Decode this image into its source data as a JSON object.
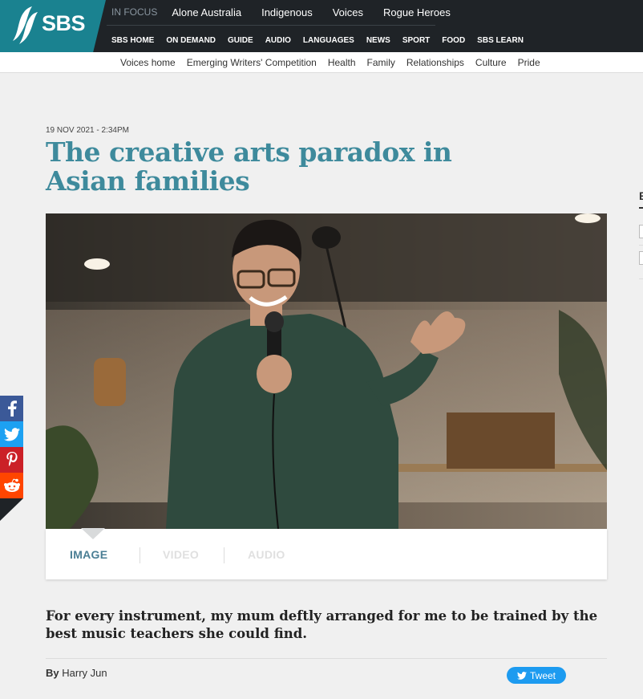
{
  "header": {
    "logo_text": "SBS",
    "in_focus_label": "IN FOCUS",
    "in_focus_items": [
      "Alone Australia",
      "Indigenous",
      "Voices",
      "Rogue Heroes"
    ],
    "main_nav": [
      "SBS HOME",
      "ON DEMAND",
      "GUIDE",
      "AUDIO",
      "LANGUAGES",
      "NEWS",
      "SPORT",
      "FOOD",
      "SBS LEARN"
    ],
    "sub_nav": [
      "Voices home",
      "Emerging Writers' Competition",
      "Health",
      "Family",
      "Relationships",
      "Culture",
      "Pride"
    ],
    "colors": {
      "bar": "#1f2327",
      "logo_bg": "#1a8290"
    }
  },
  "article": {
    "date": "19 NOV 2021 - 2:34PM",
    "headline": "The creative arts paradox in Asian families",
    "media_tabs": [
      "IMAGE",
      "VIDEO",
      "AUDIO"
    ],
    "active_tab": "IMAGE",
    "standfirst": "For every instrument, my mum deftly arranged for me to be trained by the best music teachers she could find.",
    "byline_prefix": "By",
    "author": "Harry Jun",
    "tweet_label": "Tweet",
    "headline_color": "#3e8a9c"
  },
  "share": {
    "buttons": [
      "facebook-icon",
      "twitter-icon",
      "pinterest-icon",
      "reddit-icon"
    ]
  },
  "sidebar": {
    "heading_initial": "E"
  }
}
